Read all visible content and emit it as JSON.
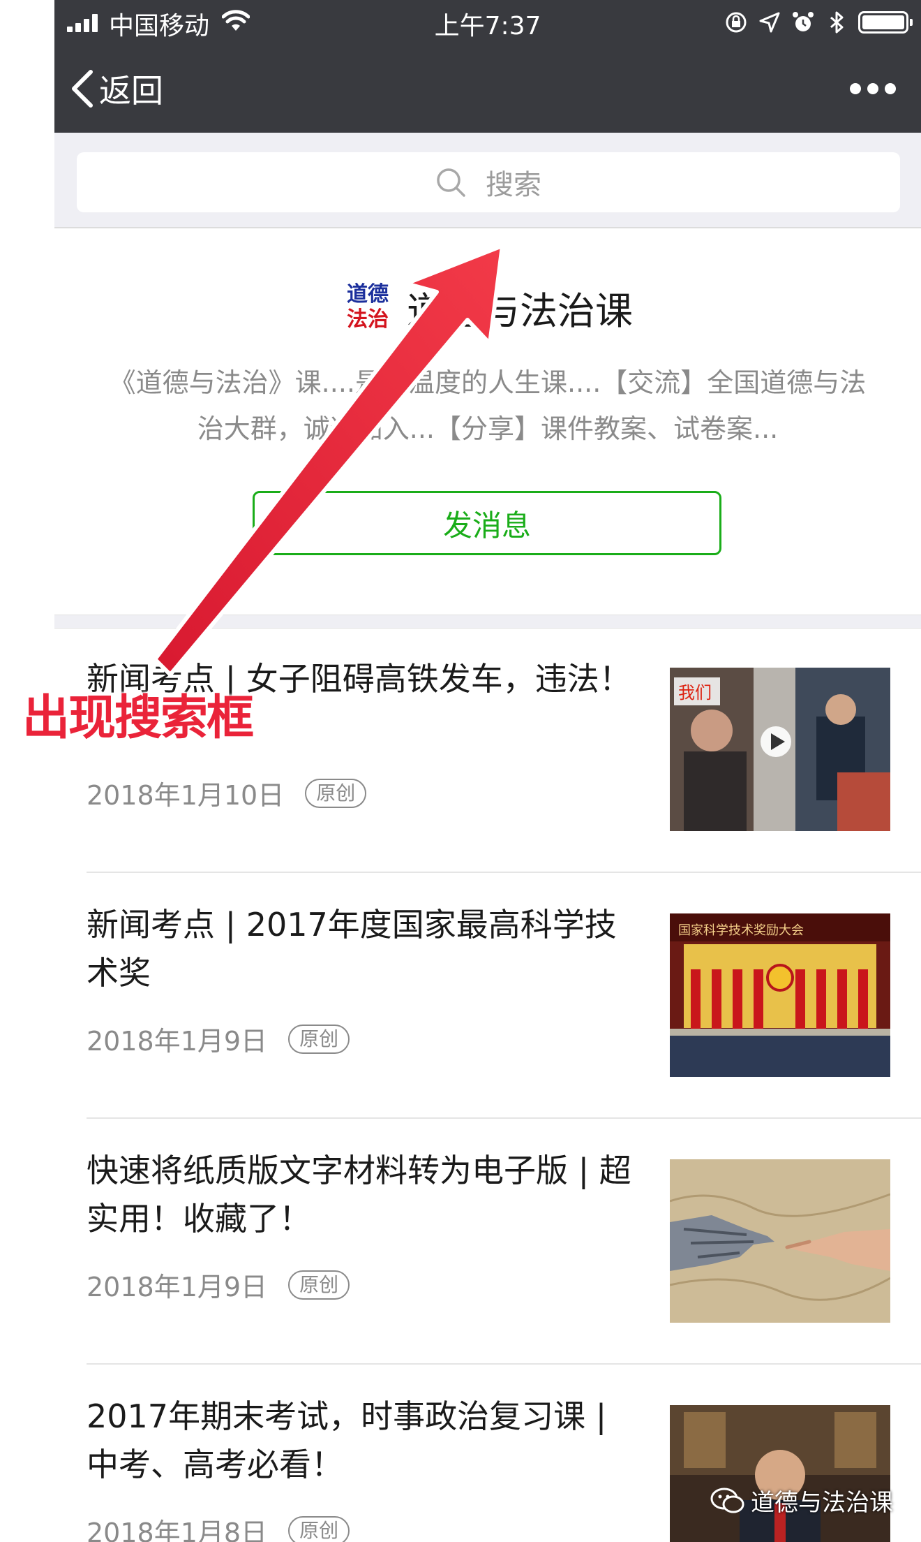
{
  "status_bar": {
    "carrier": "中国移动",
    "time": "上午7:37"
  },
  "nav": {
    "back_label": "返回"
  },
  "search": {
    "placeholder": "搜索"
  },
  "profile": {
    "logo_line1": "道德",
    "logo_line2": "法治",
    "account_name": "道德与法治课",
    "description": "《道德与法治》课....是有温度的人生课....【交流】全国道德与法治大群，诚邀加入...【分享】课件教案、试卷案...",
    "send_message_label": "发消息"
  },
  "articles": [
    {
      "title": "新闻考点 | 女子阻碍高铁发车，违法！",
      "date": "2018年1月10日",
      "badge": "原创",
      "thumb_caption": "我们"
    },
    {
      "title": "新闻考点 | 2017年度国家最高科学技术奖",
      "date": "2018年1月9日",
      "badge": "原创",
      "thumb_caption": "国家科学技术奖励大会"
    },
    {
      "title": "快速将纸质版文字材料转为电子版 | 超实用！收藏了！",
      "date": "2018年1月9日",
      "badge": "原创"
    },
    {
      "title": "2017年期末考试，时事政治复习课 | 中考、高考必看！",
      "date": "2018年1月8日",
      "badge": "原创"
    }
  ],
  "watermark": "道德与法治课",
  "annotation": {
    "label": "出现搜索框"
  },
  "colors": {
    "nav_bg": "#393a3f",
    "accent_green": "#1aad19",
    "annotation_red": "#ea2339"
  }
}
